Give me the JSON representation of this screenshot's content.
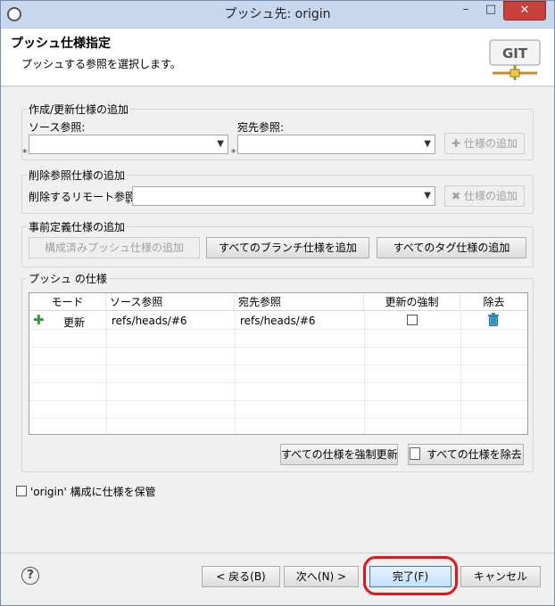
{
  "window": {
    "title": "プッシュ先: origin",
    "minimize": "–",
    "maximize": "□",
    "close": "✕"
  },
  "header": {
    "title": "プッシュ仕様指定",
    "description": "プッシュする参照を選択します。",
    "logo_text": "GIT"
  },
  "add_spec": {
    "group_title": "作成/更新仕様の追加",
    "source_label": "ソース参照:",
    "source_value": "",
    "dest_label": "宛先参照:",
    "dest_value": "",
    "add_button": "仕様の追加"
  },
  "delete_spec": {
    "group_title": "削除参照仕様の追加",
    "remote_label": "削除するリモート参照:",
    "remote_value": "",
    "add_button": "仕様の追加"
  },
  "predefined": {
    "group_title": "事前定義仕様の追加",
    "configured_button": "構成済みプッシュ仕様の追加",
    "all_branches_button": "すべてのブランチ仕様を追加",
    "all_tags_button": "すべてのタグ仕様の追加"
  },
  "push_specs": {
    "group_title": "プッシュ の仕様",
    "columns": [
      "モード",
      "ソース参照",
      "宛先参照",
      "更新の強制",
      "除去"
    ],
    "rows": [
      {
        "mode": "更新",
        "source": "refs/heads/#6",
        "dest": "refs/heads/#6",
        "force": false
      }
    ],
    "force_all_button": "すべての仕様を強制更新",
    "remove_all_button": "すべての仕様を除去"
  },
  "save_option": {
    "label": "'origin' 構成に仕様を保管",
    "checked": false
  },
  "footer": {
    "back_button": "< 戻る(B)",
    "next_button": "次へ(N) >",
    "finish_button": "完了(F)",
    "cancel_button": "キャンセル"
  },
  "colors": {
    "title_bar": "#c7d7ee",
    "close": "#c7403a",
    "highlight": "#e8141b",
    "add_icon": "#3a9a3a",
    "trash_icon": "#2a8fbf"
  }
}
